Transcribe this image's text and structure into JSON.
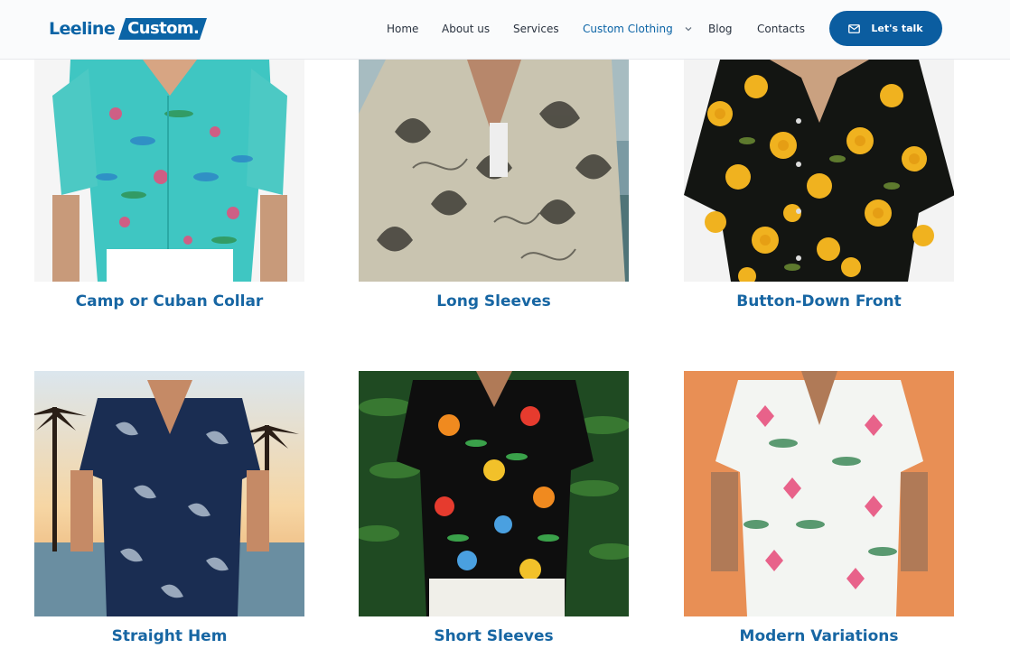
{
  "brand": {
    "logo_left": "Leeline",
    "logo_right": "Custom."
  },
  "nav": {
    "items": [
      {
        "label": "Home",
        "active": false
      },
      {
        "label": "About us",
        "active": false
      },
      {
        "label": "Services",
        "active": false
      },
      {
        "label": "Custom Clothing",
        "active": true,
        "has_dropdown": true
      },
      {
        "label": "Blog",
        "active": false
      },
      {
        "label": "Contacts",
        "active": false
      }
    ],
    "cta_label": "Let's talk"
  },
  "products": [
    {
      "caption": "Camp or Cuban Collar",
      "image": "teal tropical shirt"
    },
    {
      "caption": "Long Sleeves",
      "image": "beige floral long-sleeve shirt"
    },
    {
      "caption": "Button-Down Front",
      "image": "yellow rose print shirt"
    },
    {
      "caption": "Straight Hem",
      "image": "navy palm print shirt"
    },
    {
      "caption": "Short Sleeves",
      "image": "black tropical print shirt"
    },
    {
      "caption": "Modern Variations",
      "image": "white pink-floral shirt"
    }
  ],
  "colors": {
    "brand_blue": "#0b64a6",
    "cta_blue": "#0b5da0",
    "caption_blue": "#1766a3"
  }
}
